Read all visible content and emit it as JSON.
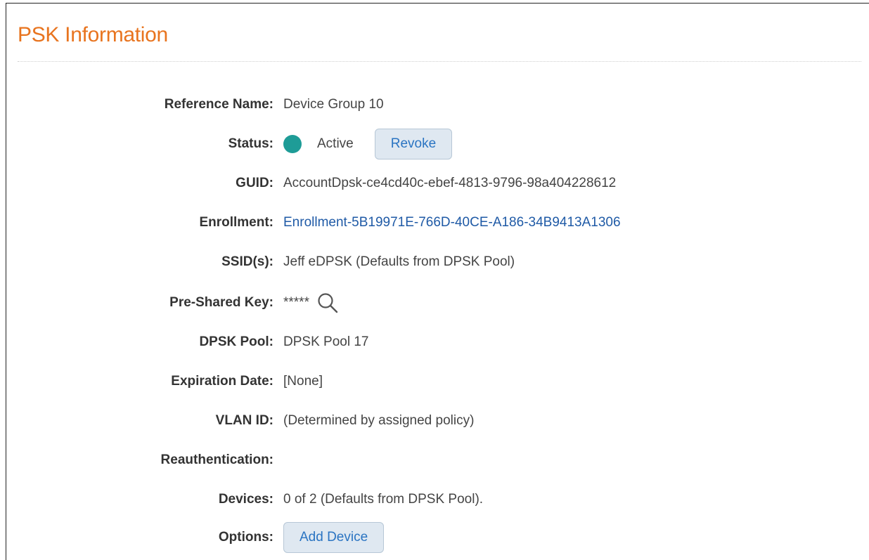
{
  "header": {
    "title": "PSK Information"
  },
  "colors": {
    "title": "#e8741f",
    "status_active": "#1e9c97",
    "link": "#1f5aa6",
    "button_text": "#2a74c2",
    "button_bg": "#dfe8f1"
  },
  "fields": {
    "reference_name": {
      "label": "Reference Name:",
      "value": "Device Group 10"
    },
    "status": {
      "label": "Status:",
      "value": "Active",
      "icon": "status-dot-icon",
      "action_label": "Revoke"
    },
    "guid": {
      "label": "GUID:",
      "value": "AccountDpsk-ce4cd40c-ebef-4813-9796-98a404228612"
    },
    "enrollment": {
      "label": "Enrollment:",
      "value": "Enrollment-5B19971E-766D-40CE-A186-34B9413A1306"
    },
    "ssids": {
      "label": "SSID(s):",
      "value": "Jeff eDPSK (Defaults from DPSK Pool)"
    },
    "psk": {
      "label": "Pre-Shared Key:",
      "value": "*****",
      "icon": "search-icon"
    },
    "dpsk_pool": {
      "label": "DPSK Pool:",
      "value": "DPSK Pool 17"
    },
    "expiration": {
      "label": "Expiration Date:",
      "value": "[None]"
    },
    "vlan": {
      "label": "VLAN ID:",
      "value": "(Determined by assigned policy)"
    },
    "reauth": {
      "label": "Reauthentication:",
      "value": ""
    },
    "devices": {
      "label": "Devices:",
      "value": "0 of 2 (Defaults from DPSK Pool)."
    },
    "options": {
      "label": "Options:",
      "action_label": "Add Device"
    }
  }
}
